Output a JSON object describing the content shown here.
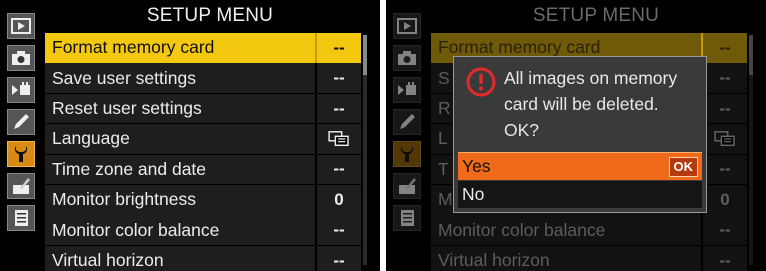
{
  "left_screen": {
    "title": "SETUP MENU",
    "sidebar_icons": [
      "playback-icon",
      "camera-icon",
      "movie-icon",
      "pencil-icon",
      "wrench-icon",
      "retouch-icon",
      "my-menu-icon"
    ],
    "active_icon": "wrench-icon",
    "items": [
      {
        "label": "Format memory card",
        "value": "--"
      },
      {
        "label": "Save user settings",
        "value": "--"
      },
      {
        "label": "Reset user settings",
        "value": "--"
      },
      {
        "label": "Language",
        "value": ""
      },
      {
        "label": "Time zone and date",
        "value": "--"
      },
      {
        "label": "Monitor brightness",
        "value": "0"
      },
      {
        "label": "Monitor color balance",
        "value": "--"
      },
      {
        "label": "Virtual horizon",
        "value": "--"
      }
    ],
    "selected_index": 0
  },
  "right_screen": {
    "title": "SETUP MENU",
    "items": [
      {
        "label": "Format memory card",
        "value": "--"
      },
      {
        "label": "S",
        "value": "--"
      },
      {
        "label": "R",
        "value": "--"
      },
      {
        "label": "L",
        "value": ""
      },
      {
        "label": "T",
        "value": "--"
      },
      {
        "label": "M",
        "value": "0"
      },
      {
        "label": "Monitor color balance",
        "value": "--"
      },
      {
        "label": "Virtual horizon",
        "value": "--"
      }
    ],
    "dialog": {
      "message_line1": "All images on memory",
      "message_line2": "card will be deleted.",
      "message_line3": "OK?",
      "yes_label": "Yes",
      "no_label": "No",
      "ok_badge": "OK"
    }
  },
  "colors": {
    "selected_row": "#f5c810",
    "yes_option": "#f06a1a",
    "warning_icon": "#e32b2b"
  }
}
